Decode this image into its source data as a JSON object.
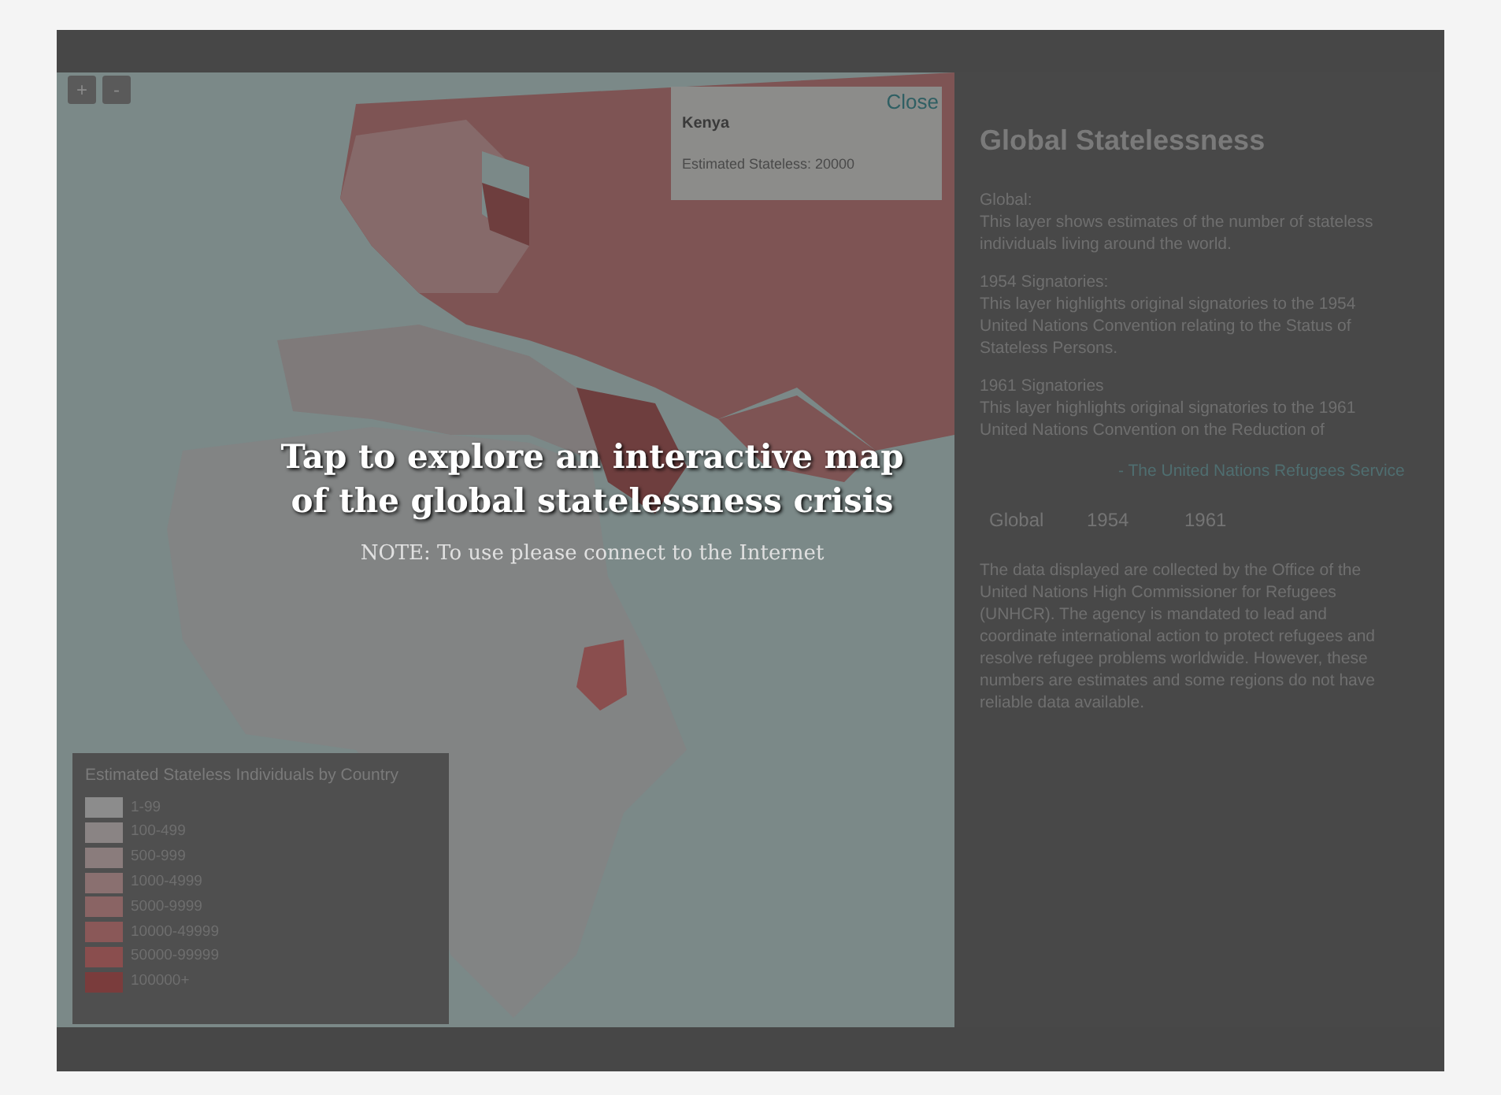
{
  "zoom_controls": [
    "+",
    "-"
  ],
  "popup": {
    "close": "Close",
    "country": "Kenya",
    "detail": "Estimated Stateless: 20000"
  },
  "panel": {
    "title": "Global Statelessness",
    "sections": [
      {
        "heading": "Global:",
        "text": "This layer shows estimates of the number of stateless individuals living around the world."
      },
      {
        "heading": "1954 Signatories:",
        "text": "This layer highlights original signatories to the 1954 United Nations Convention relating to the Status of Stateless Persons."
      },
      {
        "heading": "1961 Signatories",
        "text": "This layer highlights original signatories to the 1961 United Nations Convention on the Reduction of"
      }
    ],
    "source_link": "- The United Nations Refugees Service",
    "layers": [
      "Global",
      "1954",
      "1961"
    ],
    "about": "The data displayed are collected by the Office of the United Nations High Commissioner for Refugees (UNHCR). The agency is mandated to lead and coordinate international action to protect refugees and resolve refugee problems worldwide. However, these numbers are estimates and some regions do not have reliable data available."
  },
  "legend": {
    "title": "Estimated Stateless Individuals by Country",
    "items": [
      {
        "label": "1-99",
        "color": "#8c8c8c"
      },
      {
        "label": "100-499",
        "color": "#8a8484"
      },
      {
        "label": "500-999",
        "color": "#8a7c7c"
      },
      {
        "label": "1000-4999",
        "color": "#8a7070"
      },
      {
        "label": "5000-9999",
        "color": "#8a6464"
      },
      {
        "label": "10000-49999",
        "color": "#8a5858"
      },
      {
        "label": "50000-99999",
        "color": "#8a4e4e"
      },
      {
        "label": "100000+",
        "color": "#7a3c3c"
      }
    ]
  },
  "overlay": {
    "title_lines": [
      "Tap to explore an interactive map",
      "of the global statelessness crisis"
    ],
    "note": "NOTE: To use please connect to the Internet"
  }
}
